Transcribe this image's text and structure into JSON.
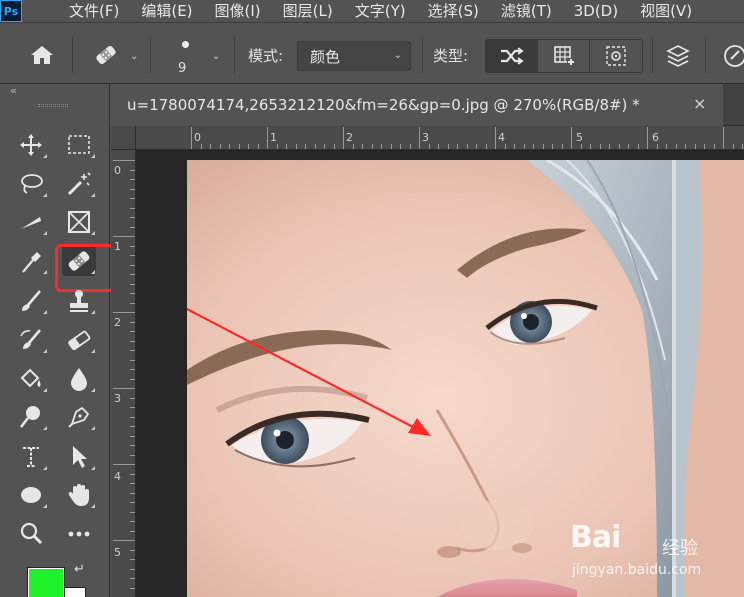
{
  "app": {
    "logo_text": "Ps"
  },
  "menu": [
    "文件(F)",
    "编辑(E)",
    "图像(I)",
    "图层(L)",
    "文字(Y)",
    "选择(S)",
    "滤镜(T)",
    "3D(D)",
    "视图(V)"
  ],
  "options": {
    "brush_size": "9",
    "mode_label": "模式:",
    "mode_value": "颜色",
    "type_label": "类型:"
  },
  "document": {
    "tab_title": "u=1780074174,2653212120&fm=26&gp=0.jpg @ 270%(RGB/8#) *",
    "close": "×"
  },
  "rulers": {
    "top": [
      "0",
      "1",
      "2",
      "3",
      "4",
      "5",
      "6"
    ],
    "left": [
      "0",
      "1",
      "2",
      "3",
      "4",
      "5"
    ]
  },
  "colors": {
    "foreground": "#1ff22a",
    "background": "#ffffff",
    "annotation": "#ff2a2a"
  },
  "watermark": {
    "logo": "Bai",
    "logo2": "经验",
    "url": "jingyan.baidu.com"
  }
}
